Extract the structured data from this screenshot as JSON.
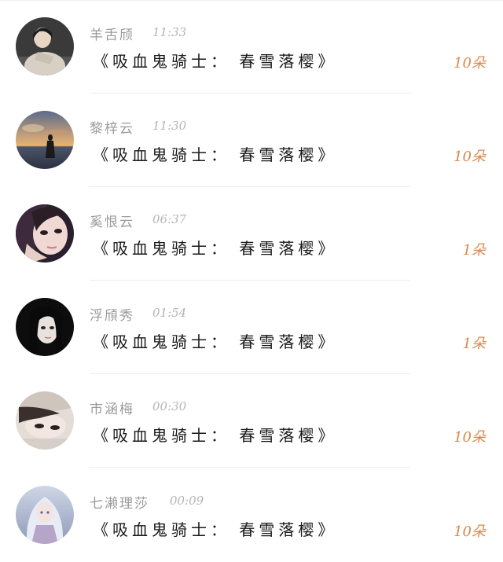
{
  "gift_list": [
    {
      "name": "羊舌颀",
      "time": "11:33",
      "title": "《吸血鬼骑士：  春雪落樱》",
      "count": "10朵",
      "avatar": "avatar-person-in-sweater"
    },
    {
      "name": "黎梓云",
      "time": "11:30",
      "title": "《吸血鬼骑士：  春雪落樱》",
      "count": "10朵",
      "avatar": "avatar-sunset-silhouette"
    },
    {
      "name": "奚恨云",
      "time": "06:37",
      "title": "《吸血鬼骑士：  春雪落樱》",
      "count": "1朵",
      "avatar": "avatar-girl-face"
    },
    {
      "name": "浮頎秀",
      "time": "01:54",
      "title": "《吸血鬼骑士：  春雪落樱》",
      "count": "1朵",
      "avatar": "avatar-girl-dark-hair"
    },
    {
      "name": "市涵梅",
      "time": "00:30",
      "title": "《吸血鬼骑士：  春雪落樱》",
      "count": "10朵",
      "avatar": "avatar-girl-lying"
    },
    {
      "name": "七濑理莎",
      "time": "00:09",
      "title": "《吸血鬼骑士：  春雪落樱》",
      "count": "10朵",
      "avatar": "avatar-anime-character"
    }
  ],
  "colors": {
    "name": "#9a9a9a",
    "time": "#b5b5b5",
    "title": "#1a1a1a",
    "count": "#d9884a"
  }
}
